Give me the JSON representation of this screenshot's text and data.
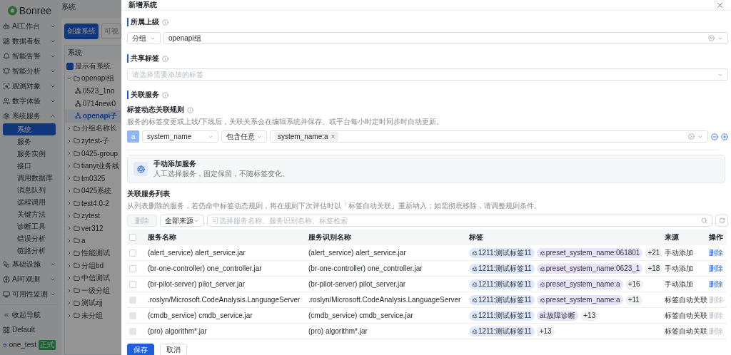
{
  "sidebar": {
    "logo": "Bonree",
    "items": [
      {
        "label": "AI工作台",
        "expanded": false
      },
      {
        "label": "数据看板",
        "expanded": false
      },
      {
        "label": "智能告警",
        "expanded": false
      },
      {
        "label": "智能分析",
        "expanded": false
      },
      {
        "label": "观测对象",
        "expanded": false
      },
      {
        "label": "数字体验",
        "expanded": false
      },
      {
        "label": "系统服务",
        "expanded": true,
        "children": [
          {
            "label": "系统",
            "selected": true
          },
          {
            "label": "服务",
            "selected": false
          },
          {
            "label": "服务实例",
            "selected": false
          },
          {
            "label": "接口",
            "selected": false
          },
          {
            "label": "调用数据库",
            "selected": false
          },
          {
            "label": "消息队列",
            "selected": false
          },
          {
            "label": "远程调用",
            "selected": false
          },
          {
            "label": "关键方法",
            "selected": false
          },
          {
            "label": "诊断工具",
            "selected": false
          },
          {
            "label": "错误分析",
            "selected": false
          },
          {
            "label": "链路分析",
            "selected": false
          }
        ]
      },
      {
        "label": "基础设施",
        "expanded": false
      },
      {
        "label": "AI可观测",
        "expanded": false
      },
      {
        "label": "可用性监测",
        "expanded": false
      }
    ],
    "collapse": "收起导航",
    "workspace": "Default",
    "user": {
      "name": "one_test",
      "badge": "正式"
    }
  },
  "content": {
    "breadcrumb": "系统",
    "buttons": [
      "创建系统",
      "可视"
    ],
    "tree": {
      "header": "系统",
      "filter": {
        "label": "显示有系统",
        "checked": true
      },
      "nodes": [
        {
          "label": "openapi组",
          "kind": "group",
          "expanded": true,
          "children": [
            {
              "label": "0523_1no",
              "kind": "system",
              "selected": false
            },
            {
              "label": "0714new0",
              "kind": "system",
              "selected": false
            },
            {
              "label": "openapi子",
              "kind": "system",
              "selected": true
            }
          ]
        },
        {
          "label": "分组名称长",
          "kind": "group",
          "expanded": false
        },
        {
          "label": "zytest-子",
          "kind": "group",
          "expanded": false
        },
        {
          "label": "0425-group",
          "kind": "group",
          "expanded": false
        },
        {
          "label": "tianyi业务线",
          "kind": "group",
          "expanded": false
        },
        {
          "label": "tm0325",
          "kind": "group",
          "expanded": false
        },
        {
          "label": "0425系统",
          "kind": "group",
          "expanded": false
        },
        {
          "label": "test4.0-2",
          "kind": "group",
          "expanded": false
        },
        {
          "label": "zytest",
          "kind": "group",
          "expanded": false
        },
        {
          "label": "ver312",
          "kind": "group",
          "expanded": false
        },
        {
          "label": "a",
          "kind": "group",
          "expanded": false
        },
        {
          "label": "性能测试",
          "kind": "group",
          "expanded": false
        },
        {
          "label": "分组bd",
          "kind": "group",
          "expanded": false
        },
        {
          "label": "中信测试",
          "kind": "group",
          "expanded": false
        },
        {
          "label": "一级分组",
          "kind": "group",
          "expanded": false
        },
        {
          "label": "测试zjj",
          "kind": "group",
          "expanded": false
        },
        {
          "label": "未分组",
          "kind": "group",
          "expanded": false
        }
      ]
    }
  },
  "drawer": {
    "title": "新增系统",
    "parent": {
      "title": "所属上级",
      "type": "分组",
      "value": "openapi组"
    },
    "shared_tags": {
      "title": "共享标签",
      "placeholder": "请选择需要添加的标签"
    },
    "services": {
      "title": "关联服务",
      "rule_title": "标签动态关联规则",
      "rule_desc": "服务的标签变更或上线/下线后，关联关系会在编辑系统并保存、或平台每小时定时同步时自动更新。",
      "rule": {
        "badge": "a",
        "key": "system_name",
        "operator": "包含任意",
        "values": [
          "system_name:a"
        ]
      },
      "manual": {
        "title": "手动添加服务",
        "desc": "人工选择服务，固定保留，不随标签变化。"
      }
    },
    "list": {
      "title": "关联服务列表",
      "desc": "从列表删除的服务，若仍命中标签动态规则，将在规则下次评估时以「标签自动关联」重新纳入；如需彻底移除，请调整规则条件。",
      "delete": {
        "label": "删除",
        "disabled": true
      },
      "source": "全部来源",
      "search_placeholder": "可选择服务名称、服务识别名称、标签检索",
      "all_checked": false,
      "columns": [
        "服务名称",
        "服务识别名称",
        "标签",
        "来源",
        "操作"
      ],
      "rows": [
        {
          "name": "(alert_service) alert_service.jar",
          "ident": "(alert_service) alert_service.jar",
          "tags": [
            {
              "kind": "shared",
              "text": "1211:测试标签11"
            },
            {
              "kind": "preset",
              "text": "preset_system_name:061801"
            },
            {
              "kind": "count",
              "text": "+21"
            }
          ],
          "source": "手动添加",
          "action": "删除",
          "disabled": false
        },
        {
          "name": "(br-one-controller) one_controller.jar",
          "ident": "(br-one-controller) one_controller.jar",
          "tags": [
            {
              "kind": "shared",
              "text": "1211:测试标签11"
            },
            {
              "kind": "preset",
              "text": "preset_system_name:0623_1"
            },
            {
              "kind": "count",
              "text": "+18"
            }
          ],
          "source": "手动添加",
          "action": "删除",
          "disabled": false
        },
        {
          "name": "(br-pilot-server) pilot_server.jar",
          "ident": "(br-pilot-server) pilot_server.jar",
          "tags": [
            {
              "kind": "shared",
              "text": "1211:测试标签11"
            },
            {
              "kind": "preset",
              "text": "preset_system_name:a"
            },
            {
              "kind": "count",
              "text": "+16"
            }
          ],
          "source": "手动添加",
          "action": "删除",
          "disabled": false
        },
        {
          "name": ".roslyn/Microsoft.CodeAnalysis.LanguageServer",
          "ident": ".roslyn/Microsoft.CodeAnalysis.LanguageServer",
          "tags": [
            {
              "kind": "shared",
              "text": "1211:测试标签11"
            },
            {
              "kind": "preset",
              "text": "preset_system_name:a"
            },
            {
              "kind": "count",
              "text": "+11"
            }
          ],
          "source": "标签自动关联",
          "action": "删除",
          "disabled": true
        },
        {
          "name": "(cmdb_service) cmdb_service.jar",
          "ident": "(cmdb_service) cmdb_service.jar",
          "tags": [
            {
              "kind": "shared",
              "text": "1211:测试标签11"
            },
            {
              "kind": "plain",
              "text": "ai:故障诊断"
            },
            {
              "kind": "count",
              "text": "+13"
            }
          ],
          "source": "标签自动关联",
          "action": "删除",
          "disabled": true
        },
        {
          "name": "(pro) algorithm*.jar",
          "ident": "(pro) algorithm*.jar",
          "tags": [
            {
              "kind": "shared",
              "text": "1211:测试标签11"
            },
            {
              "kind": "count",
              "text": "+13"
            }
          ],
          "source": "标签自动关联",
          "action": "删除",
          "disabled": true
        }
      ]
    },
    "footer": {
      "save": "保存",
      "cancel": "取消"
    }
  }
}
